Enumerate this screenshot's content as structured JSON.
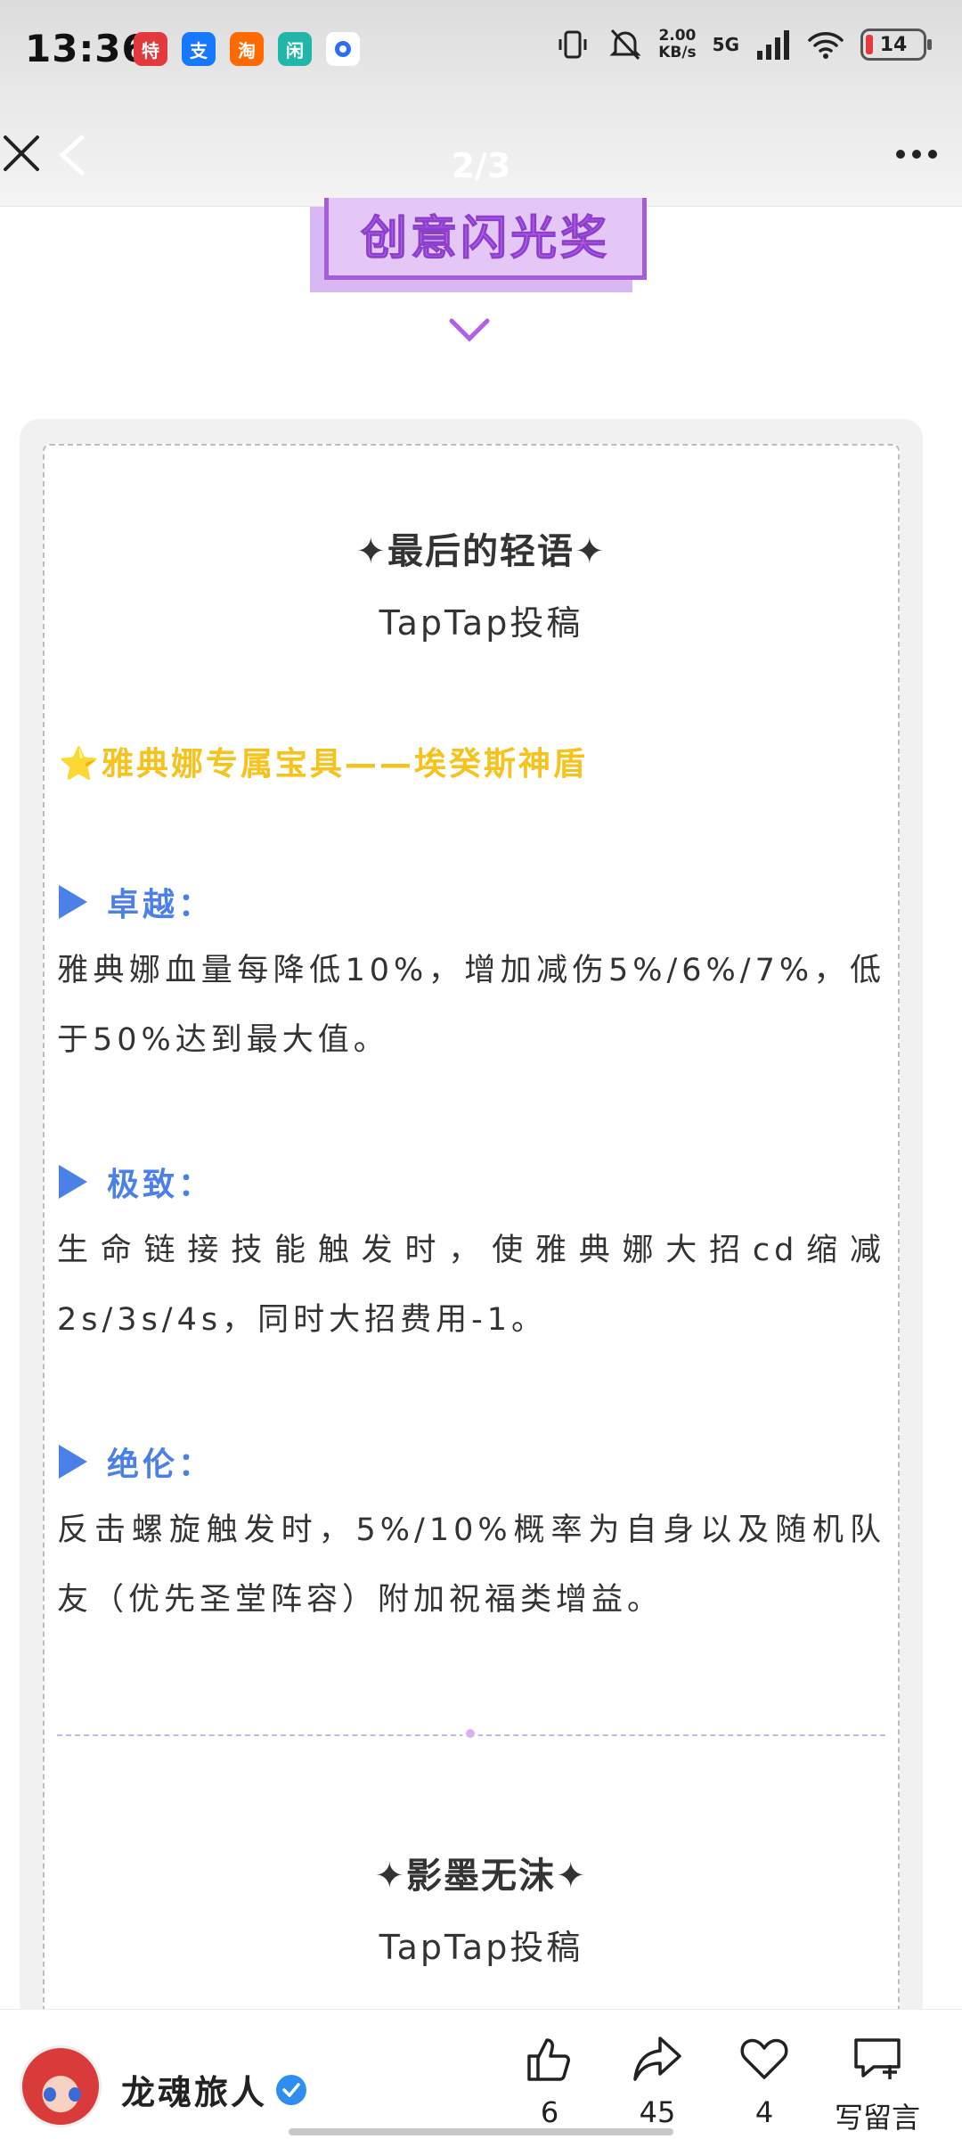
{
  "status_bar": {
    "time": "13:36",
    "apps": [
      {
        "name": "taobao-special-icon",
        "label": "特",
        "color": "#e4393c"
      },
      {
        "name": "alipay-icon",
        "label": "支",
        "color": "#1677ff"
      },
      {
        "name": "taobao-icon",
        "label": "淘",
        "color": "#ff6a00"
      },
      {
        "name": "xianyu-icon",
        "label": "闲",
        "color": "#21b6a8"
      },
      {
        "name": "dot-app-icon",
        "label": "",
        "color": "#2b6ef5"
      }
    ],
    "speed_top": "2.00",
    "speed_bottom": "KB/s",
    "network": "5G",
    "battery": "14"
  },
  "nav": {
    "page_counter": "2/3"
  },
  "award": {
    "title": "创意闪光奖"
  },
  "sections": [
    {
      "title": "✦最后的轻语✦",
      "source": "TapTap投稿",
      "treasure": "雅典娜专属宝具——埃癸斯神盾",
      "treasure_icon": "⭐",
      "traits": [
        {
          "label": "卓越：",
          "desc": "雅典娜血量每降低10%，增加减伤5%/6%/7%，低于50%达到最大值。"
        },
        {
          "label": "极致：",
          "desc": "生命链接技能触发时，使雅典娜大招cd缩减2s/3s/4s，同时大招费用-1。"
        },
        {
          "label": "绝伦：",
          "desc": "反击螺旋触发时，5%/10%概率为自身以及随机队友（优先圣堂阵容）附加祝福类增益。"
        }
      ]
    },
    {
      "title": "✦影墨无沫✦",
      "source": "TapTap投稿"
    }
  ],
  "bottom_bar": {
    "author": "龙魂旅人",
    "likes": "6",
    "shares": "45",
    "favorites": "4",
    "comment_label": "写留言"
  }
}
